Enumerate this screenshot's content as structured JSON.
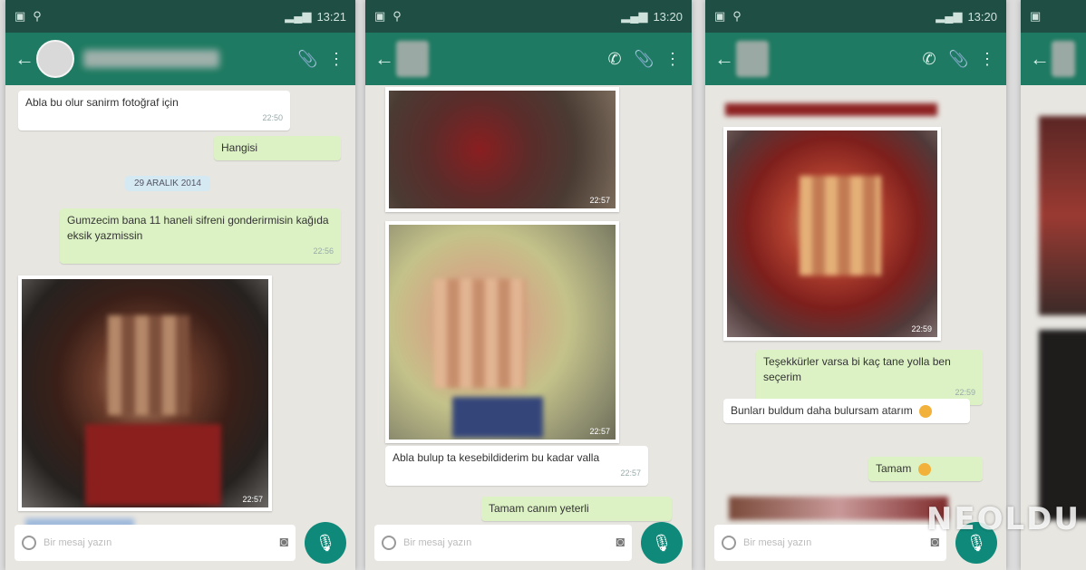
{
  "screens": [
    {
      "status_time": "13:21",
      "messages": {
        "m1": "Abla bu olur sanirm fotoğraf için",
        "m2": "Hangisi",
        "date": "29 ARALIK 2014",
        "m3": "Gumzecim bana 11 haneli sifreni gonderirmisin kağıda eksik yazmissin"
      },
      "composer_placeholder": "Bir mesaj yazın"
    },
    {
      "status_time": "13:20",
      "messages": {
        "m1": "Abla bulup ta kesebildiderim bu kadar valla",
        "m2": "Tamam canım yeterli"
      },
      "composer_placeholder": "Bir mesaj yazın"
    },
    {
      "status_time": "13:20",
      "messages": {
        "m1": "Teşekkürler varsa bi kaç tane yolla ben seçerim",
        "m2": "Bunları buldum daha bulursam atarım",
        "m3": "Tamam"
      },
      "composer_placeholder": "Bir mesaj yazın"
    }
  ],
  "watermark": "NEOLDU"
}
